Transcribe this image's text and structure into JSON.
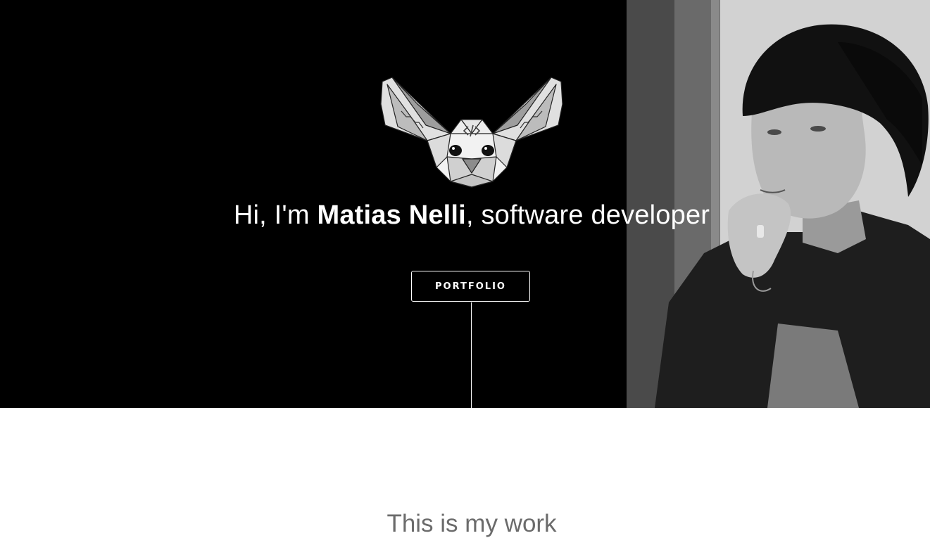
{
  "hero": {
    "headline_prefix": "Hi, I'm ",
    "headline_name": "Matias Nelli",
    "headline_suffix": ", software developer",
    "cta_label": "PORTFOLIO",
    "logo_icon": "fennec-fox-logo-icon",
    "logo_code_glyph": "</>",
    "photo": "portrait-photo"
  },
  "work": {
    "title": "This is my work"
  },
  "colors": {
    "hero_background": "#000000",
    "hero_text": "#ffffff",
    "page_background": "#ffffff",
    "section_title": "#6b6b6b"
  }
}
